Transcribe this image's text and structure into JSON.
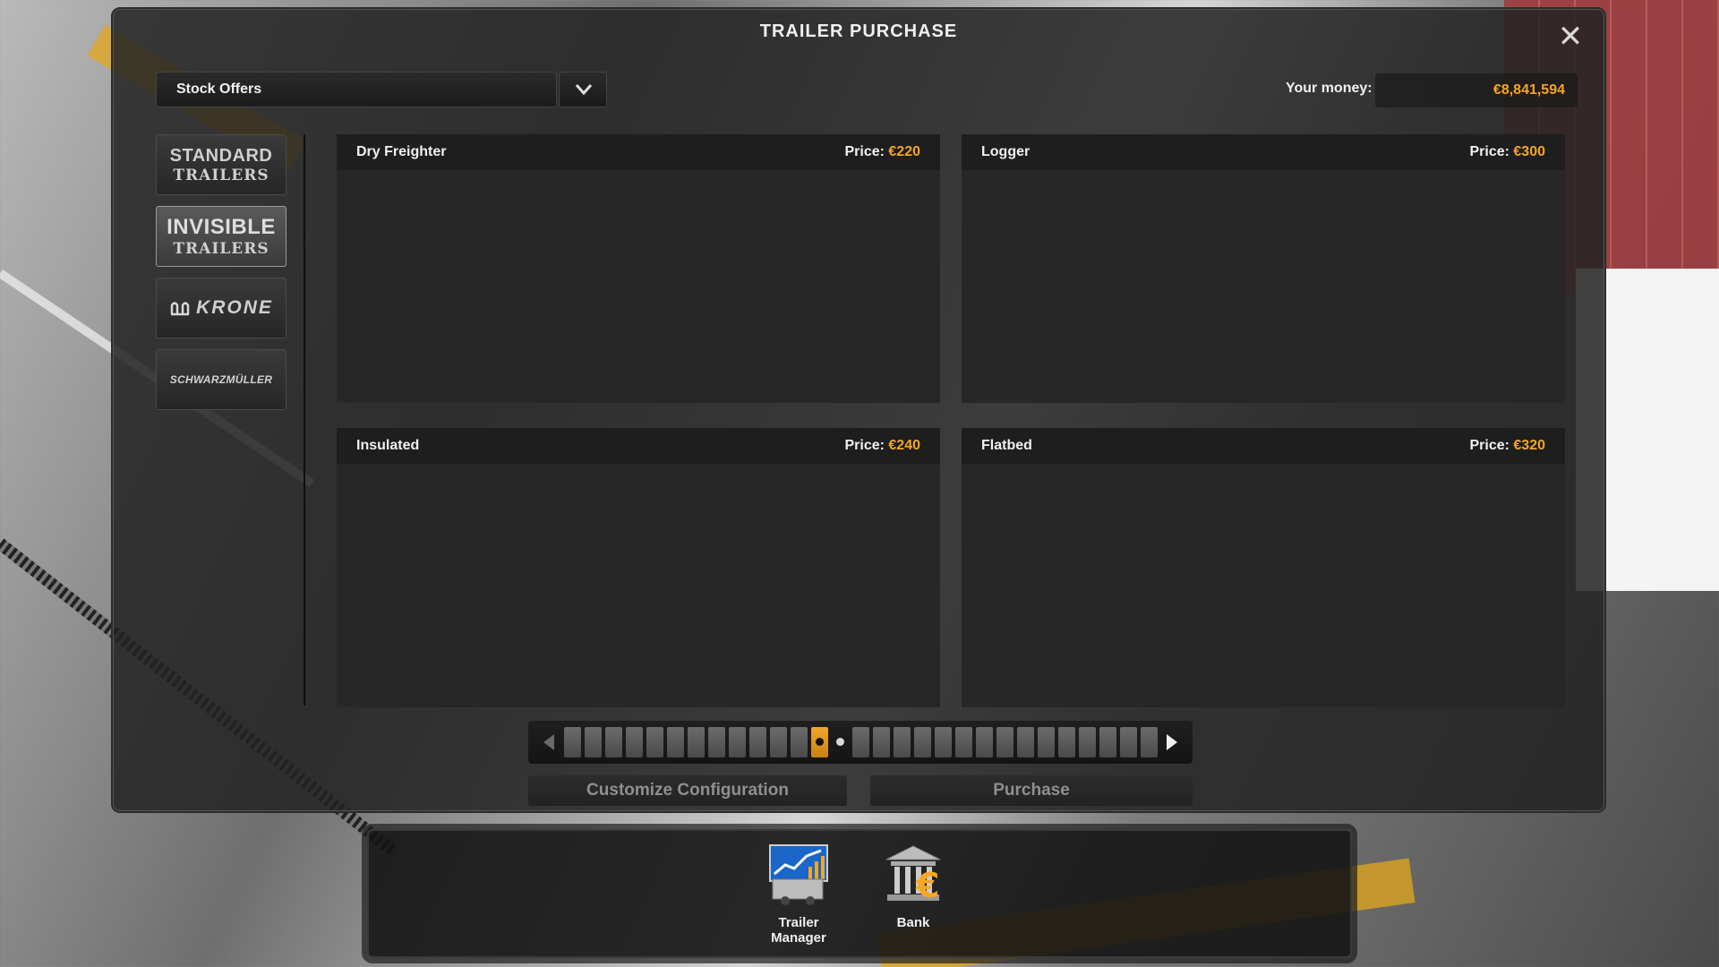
{
  "dialog": {
    "title": "TRAILER PURCHASE",
    "close_icon": "close-icon"
  },
  "dropdown": {
    "selected": "Stock Offers",
    "icon": "chevron-down-icon"
  },
  "money": {
    "label": "Your money:",
    "value": "€8,841,594"
  },
  "brands": [
    {
      "line1": "STANDARD",
      "line2": "TRAILERS",
      "active": false
    },
    {
      "line1": "INVISIBLE",
      "line2": "TRAILERS",
      "active": true
    },
    {
      "line1": "KRONE",
      "line2": "",
      "active": false
    },
    {
      "line1": "SCHWARZMÜLLER",
      "line2": "",
      "active": false
    }
  ],
  "offers": [
    {
      "name": "Dry Freighter",
      "price_label": "Price:",
      "price": "€220"
    },
    {
      "name": "Logger",
      "price_label": "Price:",
      "price": "€300"
    },
    {
      "name": "Insulated",
      "price_label": "Price:",
      "price": "€240"
    },
    {
      "name": "Flatbed",
      "price_label": "Price:",
      "price": "€320"
    }
  ],
  "pager": {
    "total_pages": 29,
    "active_page": 13
  },
  "actions": {
    "customize": "Customize Configuration",
    "purchase": "Purchase"
  },
  "bottom_bar": {
    "trailer_manager_line1": "Trailer",
    "trailer_manager_line2": "Manager",
    "bank": "Bank"
  },
  "colors": {
    "accent": "#f5a623"
  }
}
